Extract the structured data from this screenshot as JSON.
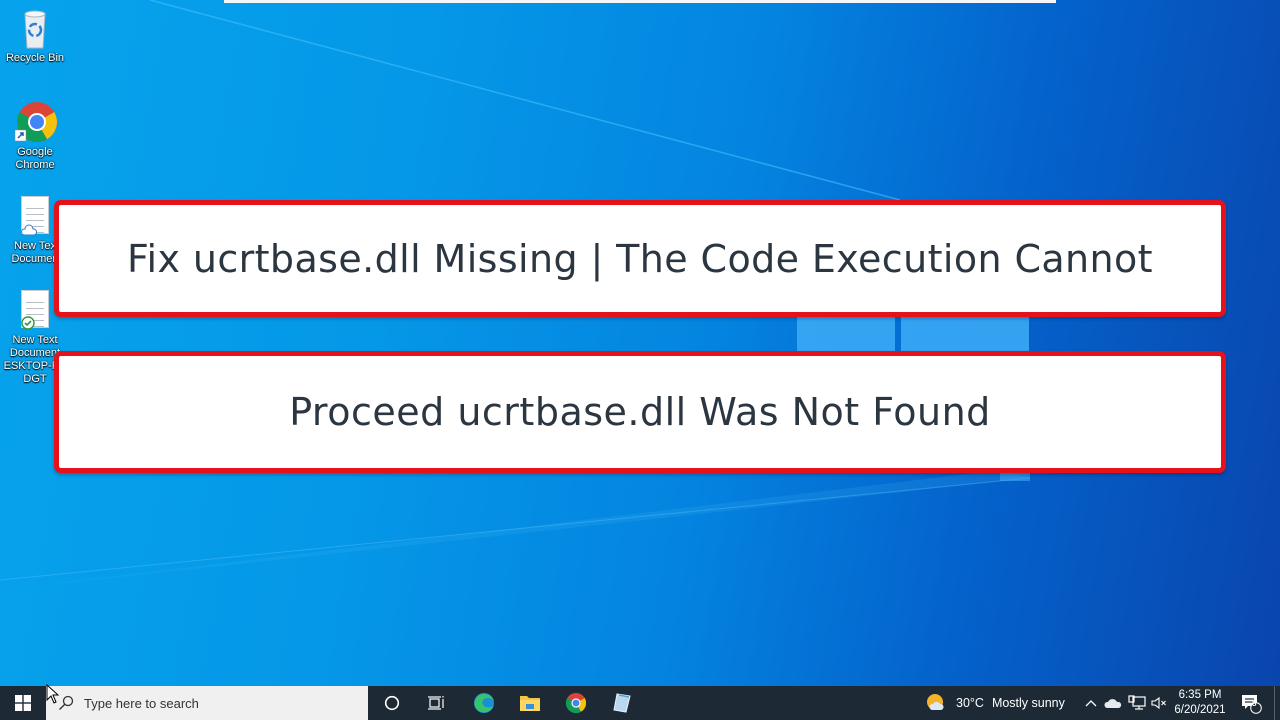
{
  "desktop": {
    "icons": [
      {
        "label_lines": [
          "Recycle Bin"
        ],
        "icon": "recycle-bin-icon"
      },
      {
        "label_lines": [
          "Google",
          "Chrome"
        ],
        "icon": "chrome-icon"
      },
      {
        "label_lines": [
          "New Tex",
          "Documen"
        ],
        "icon": "text-document-icon"
      },
      {
        "label_lines": [
          "New Text",
          "Document",
          "ESKTOP-FC",
          "DGT"
        ],
        "icon": "text-document-icon"
      }
    ]
  },
  "banners": {
    "line1": "Fix ucrtbase.dll Missing | The Code Execution Cannot",
    "line2": "Proceed ucrtbase.dll Was Not Found",
    "border_color": "#e5121b"
  },
  "taskbar": {
    "search_placeholder": "Type here to search",
    "pinned": [
      "Cortana",
      "Task View",
      "Microsoft Edge",
      "File Explorer",
      "Google Chrome",
      "Notepad"
    ],
    "weather": {
      "temp": "30°C",
      "condition": "Mostly sunny"
    },
    "clock": {
      "time": "6:35 PM",
      "date": "6/20/2021"
    },
    "notifications_count": "8"
  }
}
